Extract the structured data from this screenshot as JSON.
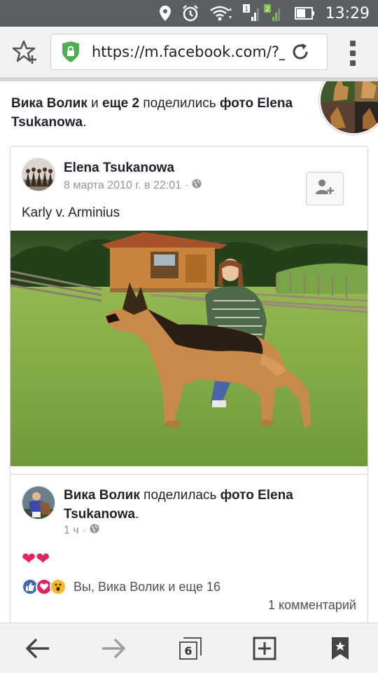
{
  "status_bar": {
    "time": "13:29",
    "sim1": "1",
    "sim2": "2"
  },
  "browser": {
    "url": "https://m.facebook.com/?_rd",
    "tab_count": "6"
  },
  "story": {
    "actor": "Вика Волик",
    "connector": " и ",
    "others": "еще 2",
    "verb": " поделились ",
    "object_prefix": "фото ",
    "object_owner": "Elena Tsukanowa",
    "end": "."
  },
  "post": {
    "author": "Elena Tsukanowa",
    "date": "8 марта 2010 г. в 22:01",
    "dot": "·",
    "caption": "Karly v. Arminius"
  },
  "share": {
    "sharer": "Вика Волик",
    "verb": " поделилась ",
    "object_prefix": "фото ",
    "object_owner": "Elena Tsukanowa",
    "end": ".",
    "time": "1 ч",
    "dot": "·",
    "hearts": "❤❤",
    "reactions_text": "Вы, Вика Волик и еще 16",
    "comments": "1 комментарий"
  },
  "colors": {
    "status_bar": "#5b5e63",
    "lock_green": "#4caf50",
    "like_blue": "#4267b2",
    "love_red": "#e0245e",
    "wow_yellow": "#f7b928"
  },
  "icons": [
    "location-icon",
    "alarm-icon",
    "wifi-icon",
    "signal-icon",
    "battery-icon",
    "star-add-icon",
    "lock-icon",
    "reload-icon",
    "menu-icon",
    "globe-icon",
    "add-friend-icon",
    "back-arrow-icon",
    "forward-arrow-icon",
    "tabs-icon",
    "new-tab-icon",
    "bookmarks-icon"
  ]
}
